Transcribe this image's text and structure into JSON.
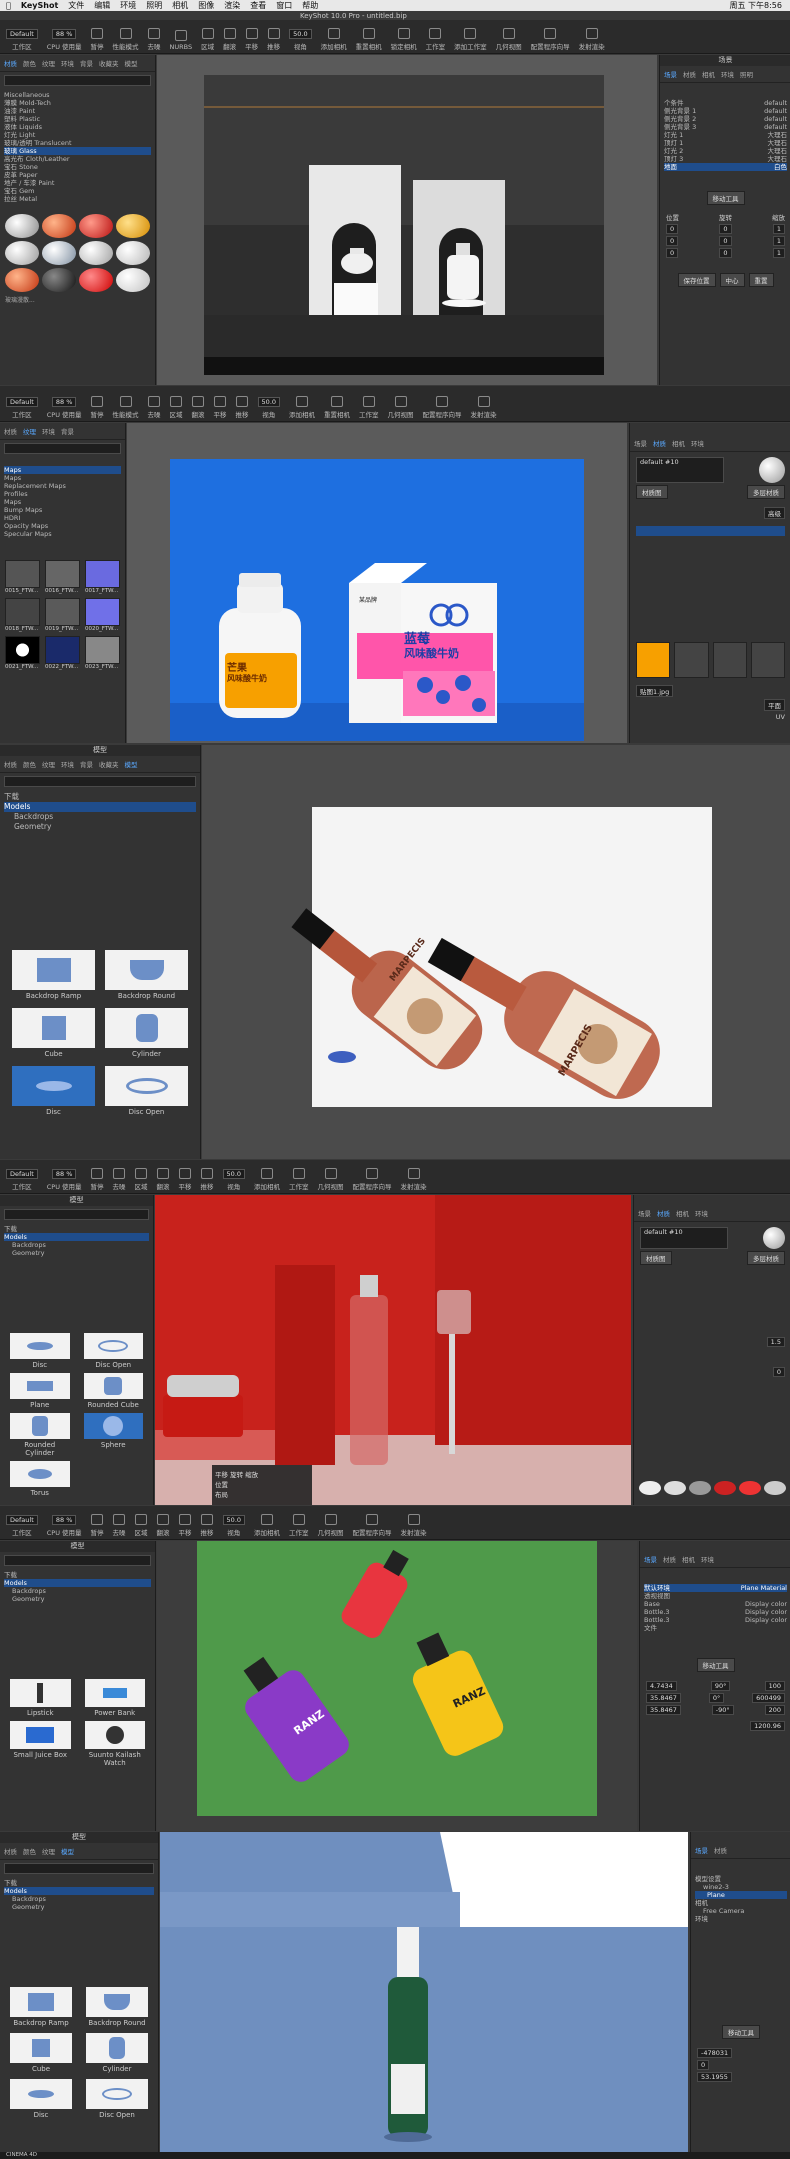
{
  "menubar": {
    "app": "KeyShot",
    "items": [
      "文件",
      "编辑",
      "环境",
      "照明",
      "相机",
      "图像",
      "渲染",
      "查看",
      "窗口",
      "帮助"
    ],
    "window_title": "KeyShot 10.0 Pro - untitled.bip",
    "clock": "周五 下午8:56"
  },
  "toolbar": {
    "workspace": "Default",
    "zoom": "88 %",
    "fov": "50.0",
    "labels": [
      "工作区",
      "CPU 使用量",
      "暂停",
      "性能模式",
      "去噪",
      "NURBS",
      "区域",
      "翻滚",
      "平移",
      "推移",
      "视角",
      "添加相机",
      "重置相机",
      "锁定相机",
      "工作室",
      "添加工作室",
      "工作室",
      "几何视图",
      "配置程序向导",
      "发射渲染"
    ]
  },
  "section1": {
    "left_tabs": [
      "材质",
      "颜色",
      "纹理",
      "环境",
      "背景",
      "收藏夹",
      "模型"
    ],
    "tree": [
      "Miscellaneous",
      "薄膜 Mold-Tech",
      "油漆 Paint",
      "塑料 Plastic",
      "液体 Liquids",
      "灯光 Light",
      "玻璃/透明 Translucent",
      "玻璃 Glass",
      "高光布 Cloth/Leather",
      "宝石 Stone",
      "皮革 Paper",
      "地产 / 车漆 Paint",
      "宝石 Gem",
      "拉丝 Metal"
    ],
    "swatch_label": "玻璃漫散...",
    "right_header": "场景",
    "right_tabs": [
      "场景",
      "材质",
      "相机",
      "环境",
      "照明",
      "图像"
    ],
    "scene_tree": [
      "个条件",
      "侧光背景 1",
      "侧光背景 2",
      "侧光背景 3",
      "灯光 1",
      "顶灯 1",
      "灯光 2",
      "顶灯 3",
      "地面"
    ],
    "scene_values": [
      "default",
      "default",
      "default",
      "default",
      "大理石",
      "大理石",
      "大理石",
      "大理石",
      "白色"
    ],
    "transform": {
      "position": "位置",
      "rotation": "旋转",
      "scale": "缩放",
      "x": "0",
      "y": "0",
      "z": "0",
      "scale_value": "1"
    },
    "buttons": [
      "移动工具",
      "保存位置",
      "中心",
      "重置"
    ]
  },
  "section2": {
    "left_tabs": [
      "材质",
      "颜色",
      "纹理",
      "环境",
      "背景",
      "收藏夹",
      "模型"
    ],
    "tree": [
      "Maps",
      "Maps",
      "Replacement Maps",
      "Profiles",
      "Maps",
      "Bump Maps",
      "HDRI",
      "Opacity Maps",
      "Specular Maps"
    ],
    "texture_labels": [
      "0015_FTW...",
      "0016_FTW...",
      "0017_FTW...",
      "0018_FTW...",
      "0019_FTW...",
      "0020_FTW...",
      "0021_FTW...",
      "0022_FTW...",
      "0023_FTW..."
    ],
    "material_name": "default #10",
    "material_type": "高级",
    "buttons": [
      "材质图",
      "多层材质"
    ],
    "tex_file": "贴图1.jpg",
    "mapping": "平面",
    "uv": "UV"
  },
  "section2_product": {
    "carton_brand": "某品牌",
    "carton_title_1": "蓝莓",
    "carton_title_2": "风味酸牛奶",
    "bottle_title_1": "芒果",
    "bottle_title_2": "风味酸牛奶"
  },
  "section3": {
    "title": "模型",
    "tabs": [
      "材质",
      "颜色",
      "纹理",
      "环境",
      "背景",
      "收藏夹",
      "模型"
    ],
    "tree_root": "下载",
    "tree": [
      "Models",
      "Backdrops",
      "Geometry"
    ],
    "thumbs": [
      "Backdrop Ramp",
      "Backdrop Round",
      "Cube",
      "Cylinder",
      "Disc",
      "Disc Open"
    ],
    "wine_label": "MARPECIS"
  },
  "section4": {
    "thumbs": [
      "Disc",
      "Disc Open",
      "Plane",
      "Rounded Cube",
      "Rounded Cylinder",
      "Sphere",
      "Torus"
    ],
    "material_name": "default #10",
    "context_menu": [
      "平移",
      "旋转",
      "缩放",
      "位置",
      "布局"
    ],
    "ior_value": "1.5",
    "roughness_value": "0"
  },
  "section5": {
    "thumbs": [
      "Lipstick",
      "Power Bank",
      "Small Juice Box",
      "Suunto Kailash Watch"
    ],
    "tree": [
      "默认环境",
      "透视视图",
      "Base",
      "Bottle.3",
      "Bottle.3",
      "文件"
    ],
    "tree_values": [
      "Plane Material",
      "Display color",
      "Display color",
      "Display color"
    ],
    "bottle_label": "RANZ",
    "coords": {
      "x": "4.7434",
      "y": "35.8467",
      "z": "35.8467",
      "rx": "90°",
      "ry": "0°",
      "rz": "-90°",
      "s1": "100",
      "s2": "600499",
      "s3": "200"
    },
    "zoom_value": "1200.96"
  },
  "section6": {
    "title": "模型",
    "tree_root": "下载",
    "tree": [
      "Models",
      "Backdrops",
      "Geometry"
    ],
    "thumbs": [
      "Backdrop Ramp",
      "Backdrop Round",
      "Cube",
      "Cylinder",
      "Disc",
      "Disc Open"
    ],
    "scene_tree": [
      "模型设置",
      "wine2-3",
      "Plane",
      "相机",
      "Free Camera",
      "环境"
    ],
    "coords": {
      "x": "-478031",
      "y": "0",
      "z": "53.1955"
    },
    "taskbar": "CINEMA 4D"
  },
  "colors": {
    "accent": "#2f6fbf",
    "panel": "#333333",
    "blue_bg": "#1e6fe0",
    "red_bg": "#c8221c",
    "green_bg": "#4f9a4a",
    "slate_bg": "#6f8fbf"
  }
}
